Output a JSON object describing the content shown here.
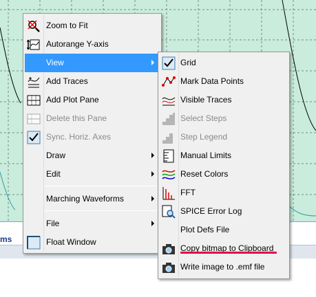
{
  "plot": {
    "bg": "#c9ecdc",
    "grid_color": "#6f8f80",
    "trace_color": "#000000",
    "trace2_color": "#2aa1a1"
  },
  "axis": {
    "label": "ms"
  },
  "menu1": {
    "items": [
      {
        "label": "Zoom to Fit",
        "icon": "zoom-to-fit-icon"
      },
      {
        "label": "Autorange Y-axis",
        "icon": "autorange-icon"
      },
      {
        "label": "View",
        "submenu": true,
        "highlighted": true
      },
      {
        "label": "Add Traces",
        "icon": "add-traces-icon"
      },
      {
        "label": "Add Plot Pane",
        "icon": "add-plot-pane-icon"
      },
      {
        "label": "Delete this Pane",
        "icon": "delete-pane-icon",
        "disabled": true
      },
      {
        "label": "Sync. Horiz. Axes",
        "icon": "checkbox-icon",
        "checked": true,
        "disabled": true
      },
      {
        "label": "Draw",
        "submenu": true
      },
      {
        "label": "Edit",
        "submenu": true
      },
      {
        "label": "Marching Waveforms",
        "submenu": true
      },
      {
        "label": "File",
        "submenu": true
      },
      {
        "label": "Float Window",
        "icon": "checkbox-icon",
        "checked": false
      }
    ]
  },
  "menu2": {
    "items": [
      {
        "label": "Grid",
        "icon": "checkbox-icon",
        "checked": true
      },
      {
        "label": "Mark Data Points",
        "icon": "mark-data-points-icon"
      },
      {
        "label": "Visible Traces",
        "icon": "visible-traces-icon"
      },
      {
        "label": "Select Steps",
        "icon": "select-steps-icon",
        "disabled": true
      },
      {
        "label": "Step Legend",
        "icon": "step-legend-icon",
        "disabled": true
      },
      {
        "label": "Manual Limits",
        "icon": "manual-limits-icon"
      },
      {
        "label": "Reset Colors",
        "icon": "reset-colors-icon"
      },
      {
        "label": "FFT",
        "icon": "fft-icon"
      },
      {
        "label": "SPICE Error Log",
        "icon": "spice-error-log-icon"
      },
      {
        "label": "Plot Defs File"
      },
      {
        "label": "Copy bitmap to Clipboard",
        "icon": "camera-icon"
      },
      {
        "label": "Write image to .emf file",
        "icon": "camera-icon"
      }
    ]
  },
  "annotation": {
    "underline_color": "#e3004f"
  }
}
